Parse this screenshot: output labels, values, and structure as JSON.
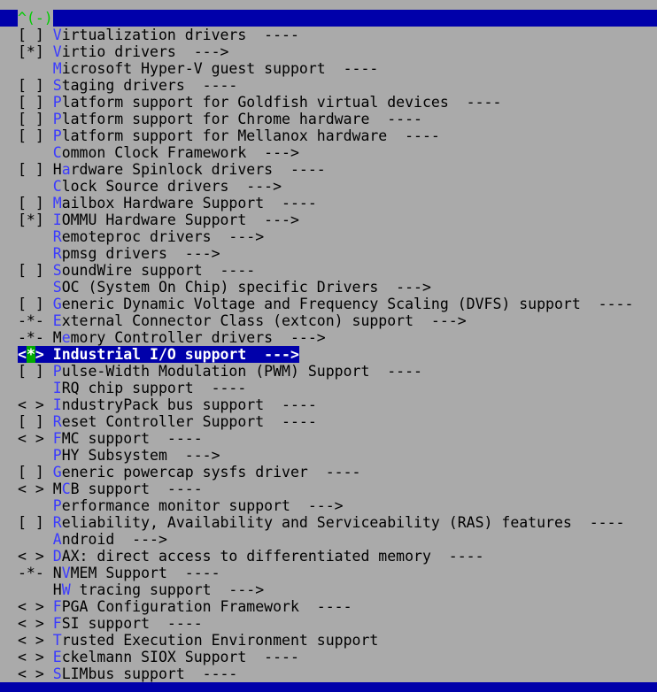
{
  "top_bar": {
    "scroll_indicator": "^(-)"
  },
  "colors": {
    "background": "#aaaaaa",
    "bar": "#0000aa",
    "hotkey": "#3a3aff",
    "selected_bg": "#0000aa",
    "selected_marker": "#00aa00",
    "scroll_indicator": "#00cc00"
  },
  "menu": {
    "items": [
      {
        "status": "[ ]",
        "hotkey": "V",
        "rest": "irtualization drivers  ----"
      },
      {
        "status": "[*]",
        "hotkey": "V",
        "rest": "irtio drivers  --->"
      },
      {
        "status": "   ",
        "hotkey": "M",
        "rest": "icrosoft Hyper-V guest support  ----"
      },
      {
        "status": "[ ]",
        "hotkey": "S",
        "rest": "taging drivers  ----"
      },
      {
        "status": "[ ]",
        "hotkey": "P",
        "rest": "latform support for Goldfish virtual devices  ----"
      },
      {
        "status": "[ ]",
        "hotkey": "P",
        "rest": "latform support for Chrome hardware  ----"
      },
      {
        "status": "[ ]",
        "hotkey": "P",
        "rest": "latform support for Mellanox hardware  ----"
      },
      {
        "status": "   ",
        "hotkey": "C",
        "rest": "ommon Clock Framework  --->"
      },
      {
        "status": "[ ]",
        "pre": "H",
        "hotkey": "a",
        "rest": "rdware Spinlock drivers  ----"
      },
      {
        "status": "   ",
        "hotkey": "C",
        "rest": "lock Source drivers  --->"
      },
      {
        "status": "[ ]",
        "hotkey": "M",
        "rest": "ailbox Hardware Support  ----"
      },
      {
        "status": "[*]",
        "hotkey": "I",
        "rest": "OMMU Hardware Support  --->"
      },
      {
        "status": "   ",
        "hotkey": "R",
        "rest": "emoteproc drivers  --->"
      },
      {
        "status": "   ",
        "hotkey": "R",
        "rest": "pmsg drivers  --->"
      },
      {
        "status": "[ ]",
        "hotkey": "S",
        "rest": "oundWire support  ----"
      },
      {
        "status": "   ",
        "hotkey": "S",
        "rest": "OC (System On Chip) specific Drivers  --->"
      },
      {
        "status": "[ ]",
        "hotkey": "G",
        "rest": "eneric Dynamic Voltage and Frequency Scaling (DVFS) support  ----"
      },
      {
        "status": "-*-",
        "hotkey": "E",
        "rest": "xternal Connector Class (extcon) support  --->"
      },
      {
        "status": "-*-",
        "pre": "M",
        "hotkey": "e",
        "rest": "mory Controller drivers  --->"
      },
      {
        "status": "<*>",
        "hotkey": "I",
        "rest": "ndustrial I/O support  --->",
        "selected": true
      },
      {
        "status": "[ ]",
        "hotkey": "P",
        "rest": "ulse-Width Modulation (PWM) Support  ----"
      },
      {
        "status": "   ",
        "hotkey": "I",
        "rest": "RQ chip support  ----"
      },
      {
        "status": "< >",
        "hotkey": "I",
        "rest": "ndustryPack bus support  ----"
      },
      {
        "status": "[ ]",
        "hotkey": "R",
        "rest": "eset Controller Support  ----"
      },
      {
        "status": "< >",
        "hotkey": "F",
        "rest": "MC support  ----"
      },
      {
        "status": "   ",
        "hotkey": "P",
        "rest": "HY Subsystem  --->"
      },
      {
        "status": "[ ]",
        "hotkey": "G",
        "rest": "eneric powercap sysfs driver  ----"
      },
      {
        "status": "< >",
        "pre": "M",
        "hotkey": "C",
        "rest": "B support  ----"
      },
      {
        "status": "   ",
        "hotkey": "P",
        "rest": "erformance monitor support  --->"
      },
      {
        "status": "[ ]",
        "hotkey": "R",
        "rest": "eliability, Availability and Serviceability (RAS) features  ----"
      },
      {
        "status": "   ",
        "hotkey": "A",
        "rest": "ndroid  --->"
      },
      {
        "status": "< >",
        "hotkey": "D",
        "rest": "AX: direct access to differentiated memory  ----"
      },
      {
        "status": "-*-",
        "pre": "N",
        "hotkey": "V",
        "rest": "MEM Support  ----"
      },
      {
        "status": "   ",
        "pre": "H",
        "hotkey": "W",
        "rest": " tracing support  --->"
      },
      {
        "status": "< >",
        "hotkey": "F",
        "rest": "PGA Configuration Framework  ----"
      },
      {
        "status": "< >",
        "hotkey": "F",
        "rest": "SI support  ----"
      },
      {
        "status": "< >",
        "hotkey": "T",
        "rest": "rusted Execution Environment support"
      },
      {
        "status": "< >",
        "hotkey": "E",
        "rest": "ckelmann SIOX Support  ----"
      },
      {
        "status": "< >",
        "hotkey": "S",
        "rest": "LIMbus support  ----"
      }
    ]
  }
}
